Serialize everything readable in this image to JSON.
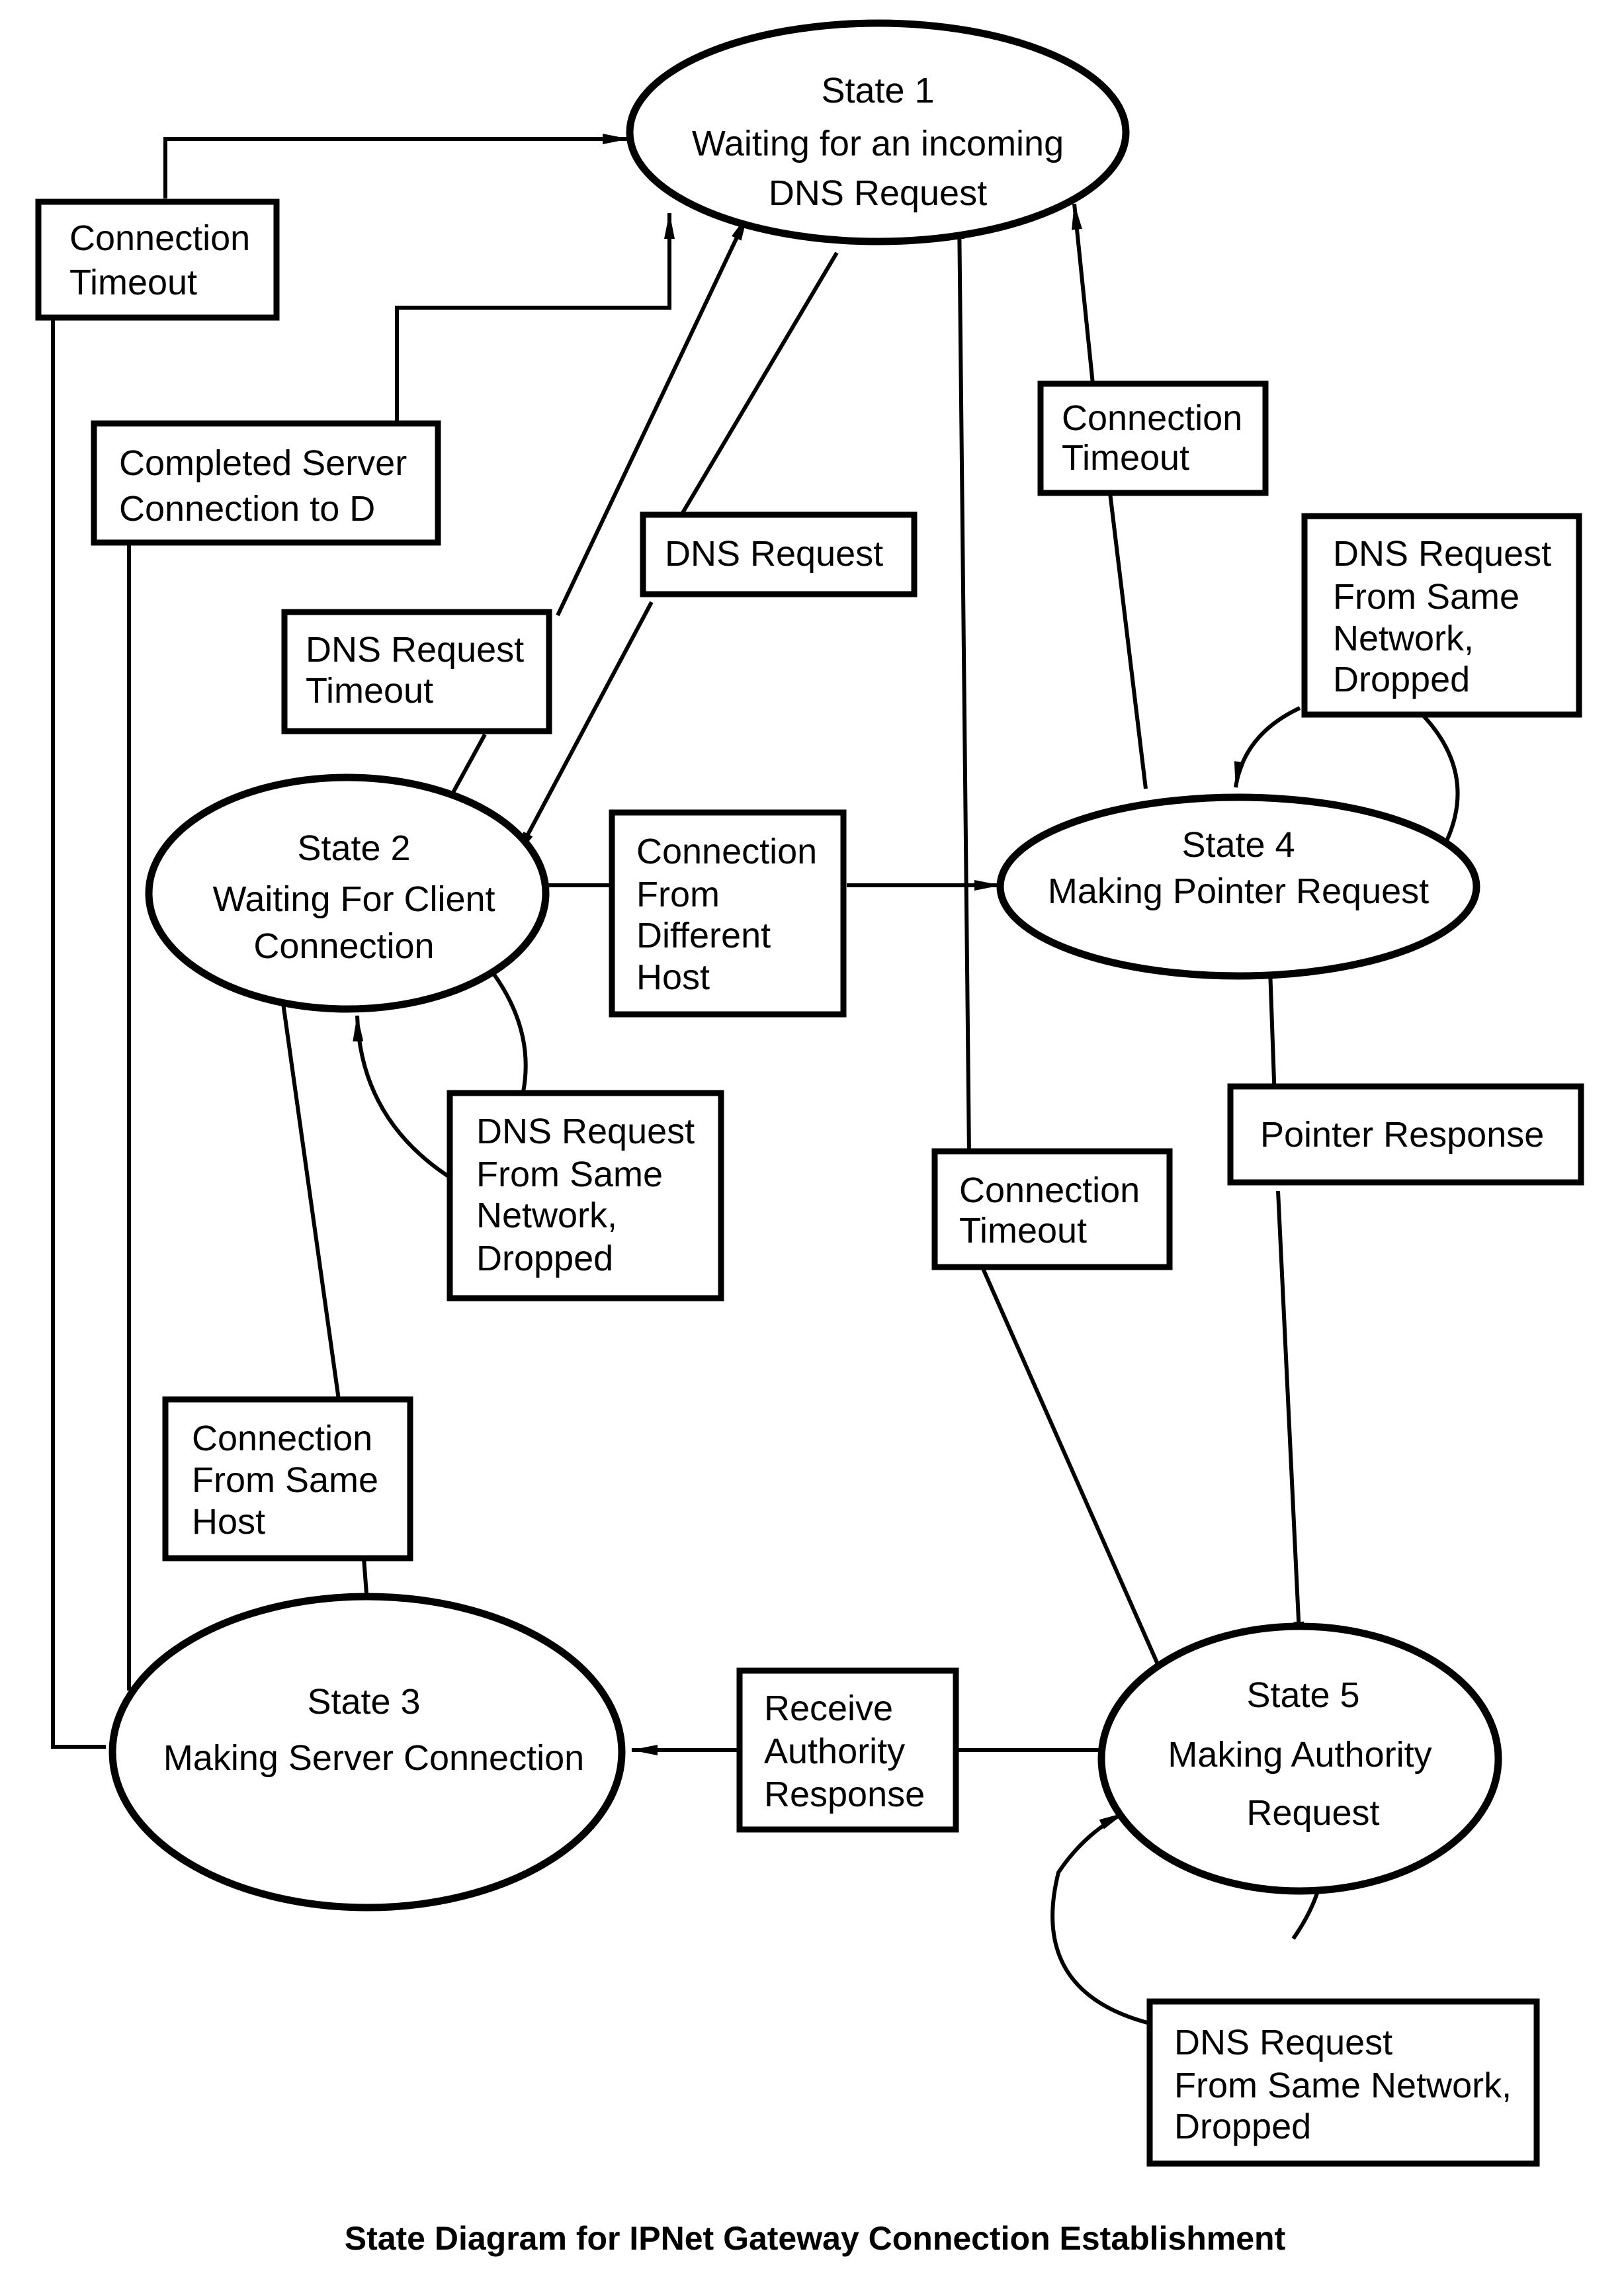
{
  "diagram": {
    "type": "state-diagram",
    "caption": "State Diagram for IPNet Gateway Connection Establishment",
    "states": [
      {
        "id": "s1",
        "lines": [
          "State 1",
          "Waiting for an incoming",
          "DNS Request"
        ]
      },
      {
        "id": "s2",
        "lines": [
          "State 2",
          "Waiting For Client",
          "Connection"
        ]
      },
      {
        "id": "s3",
        "lines": [
          "State 3",
          "Making Server Connection"
        ]
      },
      {
        "id": "s4",
        "lines": [
          "State 4",
          "Making Pointer Request"
        ]
      },
      {
        "id": "s5",
        "lines": [
          "State 5",
          "Making Authority",
          "Request"
        ]
      }
    ],
    "transitions": [
      {
        "id": "t1",
        "from": "s3",
        "to": "s1",
        "lines": [
          "Connection",
          "Timeout"
        ]
      },
      {
        "id": "t2",
        "from": "s3",
        "to": "s1",
        "lines": [
          "Completed Server",
          "Connection to D"
        ]
      },
      {
        "id": "t3",
        "from": "s2",
        "to": "s1",
        "lines": [
          "DNS Request",
          "Timeout"
        ]
      },
      {
        "id": "t4",
        "from": "s1",
        "to": "s2",
        "lines": [
          "DNS Request"
        ]
      },
      {
        "id": "t5",
        "from": "s4",
        "to": "s1",
        "lines": [
          "Connection",
          "Timeout"
        ]
      },
      {
        "id": "t6",
        "from": "s4",
        "to": "s4",
        "lines": [
          "DNS Request",
          "From Same",
          "Network,",
          "Dropped"
        ]
      },
      {
        "id": "t7",
        "from": "s2",
        "to": "s4",
        "lines": [
          "Connection",
          "From",
          "Different",
          "Host"
        ]
      },
      {
        "id": "t8",
        "from": "s2",
        "to": "s2",
        "lines": [
          "DNS Request",
          "From Same",
          "Network,",
          "Dropped"
        ]
      },
      {
        "id": "t9",
        "from": "s5",
        "to": "s1",
        "lines": [
          "Connection",
          "Timeout"
        ]
      },
      {
        "id": "t10",
        "from": "s4",
        "to": "s5",
        "lines": [
          "Pointer Response"
        ]
      },
      {
        "id": "t11",
        "from": "s2",
        "to": "s3",
        "lines": [
          "Connection",
          "From Same",
          "Host"
        ]
      },
      {
        "id": "t12",
        "from": "s5",
        "to": "s3",
        "lines": [
          "Receive",
          "Authority",
          "Response"
        ]
      },
      {
        "id": "t13",
        "from": "s5",
        "to": "s5",
        "lines": [
          "DNS Request",
          "From Same Network,",
          "Dropped"
        ]
      }
    ]
  }
}
